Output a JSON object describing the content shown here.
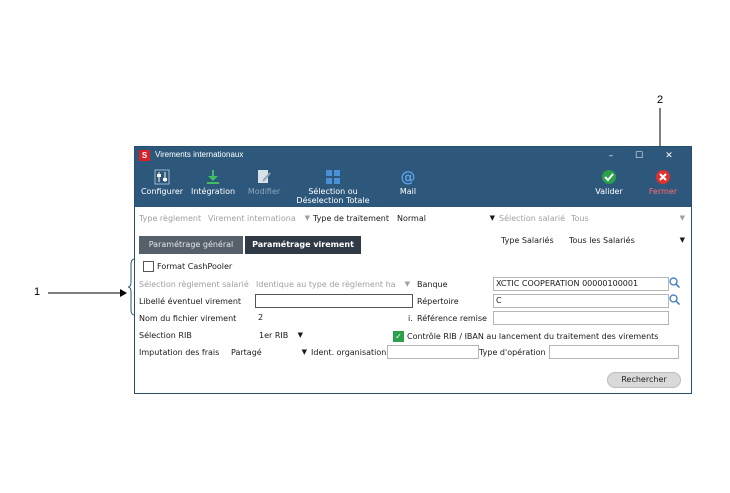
{
  "callouts": {
    "one": "1",
    "two": "2"
  },
  "window": {
    "title": "Virements internationaux",
    "app_icon_letter": "S"
  },
  "toolbar": {
    "configurer": "Configurer",
    "integration": "Intégration",
    "modifier": "Modifier",
    "selection_line1": "Sélection ou",
    "selection_line2": "Déselection Totale",
    "mail": "Mail",
    "valider": "Valider",
    "fermer": "Fermer"
  },
  "filters": {
    "type_reglement_label": "Type règlement",
    "type_reglement_value": "Virement internationa",
    "type_traitement_label": "Type de traitement",
    "type_traitement_value": "Normal",
    "selection_salarie_label": "Sélection salarié",
    "selection_salarie_value": "Tous",
    "type_salaries_label": "Type Salariés",
    "type_salaries_value": "Tous les Salariés"
  },
  "tabs": {
    "general": "Paramétrage général",
    "virement": "Paramétrage virement"
  },
  "form": {
    "format_cashpooler": "Format CashPooler",
    "selection_reglement_label": "Sélection règlement salarié",
    "selection_reglement_value": "Identique au type de règlement ha",
    "banque_label": "Banque",
    "banque_value": "XCTIC COOPERATION 00000100001",
    "libelle_label": "Libellé éventuel virement",
    "libelle_value": "",
    "repertoire_label": "Répertoire",
    "repertoire_value": "C",
    "nom_fichier_label": "Nom du fichier virement",
    "nom_fichier_value": "2",
    "nom_fichier_suffix": "i.",
    "reference_remise_label": "Référence remise",
    "reference_remise_value": "",
    "selection_rib_label": "Sélection RIB",
    "selection_rib_value": "1er RIB",
    "controle_rib_label": "Contrôle RIB / IBAN au lancement du traitement des virements",
    "imputation_label": "Imputation des frais",
    "imputation_value": "Partagé",
    "ident_org_label": "Ident. organisation",
    "ident_org_value": "",
    "type_operation_label": "Type d'opération",
    "type_operation_value": "",
    "rechercher": "Rechercher"
  },
  "colors": {
    "titlebar": "#2d587c",
    "tab_active": "#2f3a46",
    "tab_inactive": "#55606b",
    "check_green": "#2aa04a",
    "fermer_red": "#e0312e",
    "accent_blue": "#3a78c2"
  }
}
